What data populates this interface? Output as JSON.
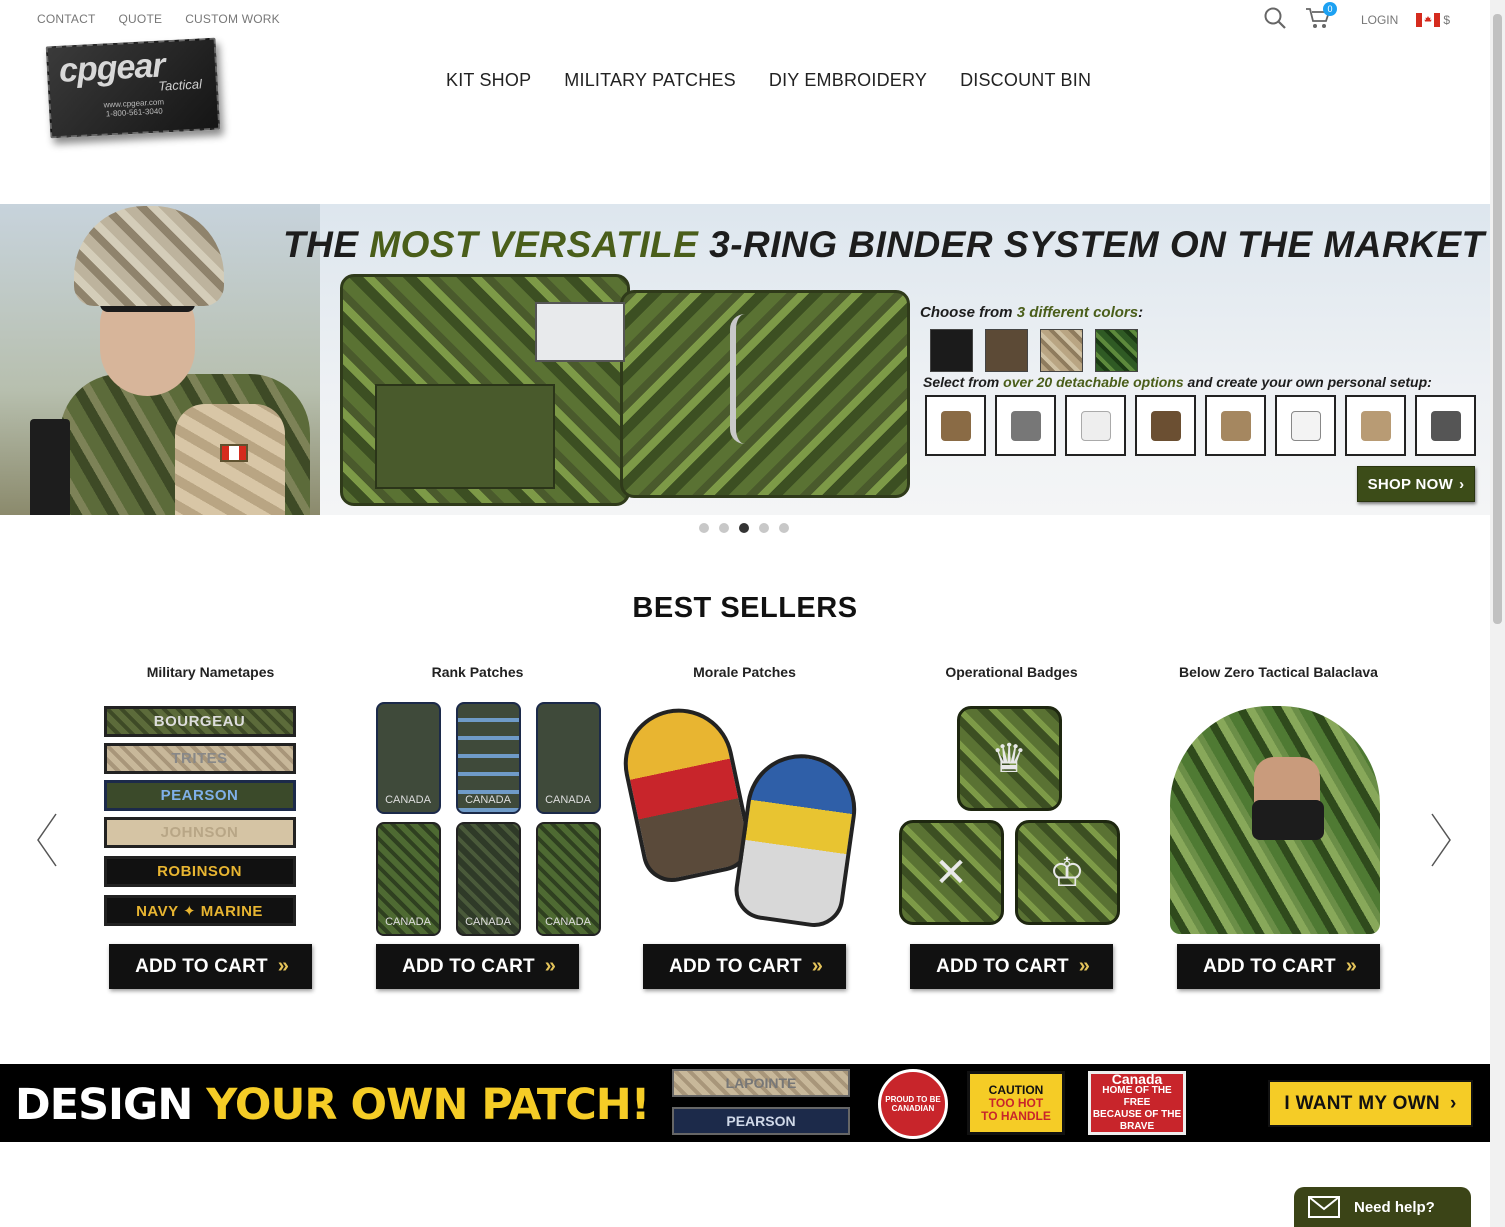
{
  "util": {
    "links": [
      "CONTACT",
      "QUOTE",
      "CUSTOM WORK"
    ],
    "cart_count": "0",
    "login": "LOGIN",
    "currency": "$"
  },
  "logo": {
    "main": "cpgear",
    "sub": "Tactical",
    "url": "www.cpgear.com",
    "phone": "1-800-561-3040"
  },
  "nav": [
    "KIT SHOP",
    "MILITARY PATCHES",
    "DIY EMBROIDERY",
    "DISCOUNT BIN"
  ],
  "hero": {
    "title_pre": "THE ",
    "title_hl": "MOST VERSATILE",
    "title_post": " 3-RING BINDER SYSTEM ON THE MARKET",
    "choose_pre": "Choose from ",
    "choose_hl": "3 different colors",
    "choose_post": ":",
    "select_pre": "Select from ",
    "select_hl": "over 20 detachable options",
    "select_post": " and create your own personal setup:",
    "cta": "SHOP NOW",
    "swatch_colors": [
      "#1b1b1b",
      "#5c4a36",
      "#a8957a",
      "#2f5a24"
    ],
    "slide_count": 5,
    "active_slide": 3
  },
  "best_sellers": {
    "title": "BEST SELLERS",
    "add_to_cart": "ADD TO CART",
    "products": [
      {
        "name": "Military Nametapes"
      },
      {
        "name": "Rank Patches"
      },
      {
        "name": "Morale Patches"
      },
      {
        "name": "Operational Badges"
      },
      {
        "name": "Below Zero Tactical Balaclava"
      }
    ],
    "nametapes": [
      "BOURGEAU",
      "TRITES",
      "PEARSON",
      "JOHNSON",
      "ROBINSON",
      "NAVY ✦ MARINE"
    ],
    "rank_label": "CANADA"
  },
  "patch_banner": {
    "title_w": "DESIGN ",
    "title_y": "YOUR OWN PATCH!",
    "tape1": "LAPOINTE",
    "tape2": "PEARSON",
    "round": "PROUD TO BE CANADIAN",
    "caution_1": "CAUTION",
    "caution_2": "TOO HOT",
    "caution_3": "TO HANDLE",
    "canada_1": "Canada",
    "canada_2": "HOME OF THE FREE",
    "canada_3": "BECAUSE OF THE BRAVE",
    "cta": "I WANT MY OWN"
  },
  "help": {
    "label": "Need help?"
  }
}
